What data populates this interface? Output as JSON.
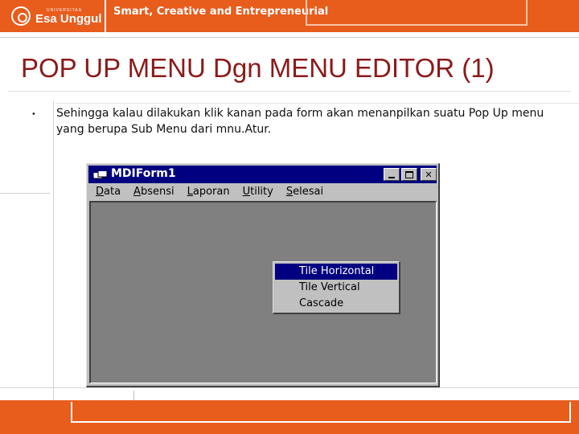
{
  "header": {
    "logo_small": "UNIVERSITAS",
    "logo_text": "Esa Unggul",
    "tagline": "Smart, Creative and Entrepreneurial"
  },
  "slide": {
    "title": "POP UP MENU  Dgn MENU EDITOR (1)",
    "bullet_glyph": "•",
    "bullet_text": "Sehingga kalau dilakukan klik kanan pada form akan menanpilkan suatu Pop Up menu yang berupa Sub Menu dari mnu.Atur."
  },
  "window": {
    "title": "MDIForm1",
    "menu": [
      {
        "accel": "D",
        "rest": "ata"
      },
      {
        "accel": "A",
        "rest": "bsensi"
      },
      {
        "accel": "L",
        "rest": "aporan"
      },
      {
        "accel": "U",
        "rest": "tility"
      },
      {
        "accel": "S",
        "rest": "elesai"
      }
    ],
    "popup": [
      {
        "label": "Tile Horizontal",
        "selected": true
      },
      {
        "label": "Tile Vertical",
        "selected": false
      },
      {
        "label": "Cascade",
        "selected": false
      }
    ]
  },
  "colors": {
    "brand_orange": "#e85c1c",
    "title_red": "#8b1a1a",
    "titlebar_navy": "#000080",
    "mdi_client_gray": "#808080"
  }
}
